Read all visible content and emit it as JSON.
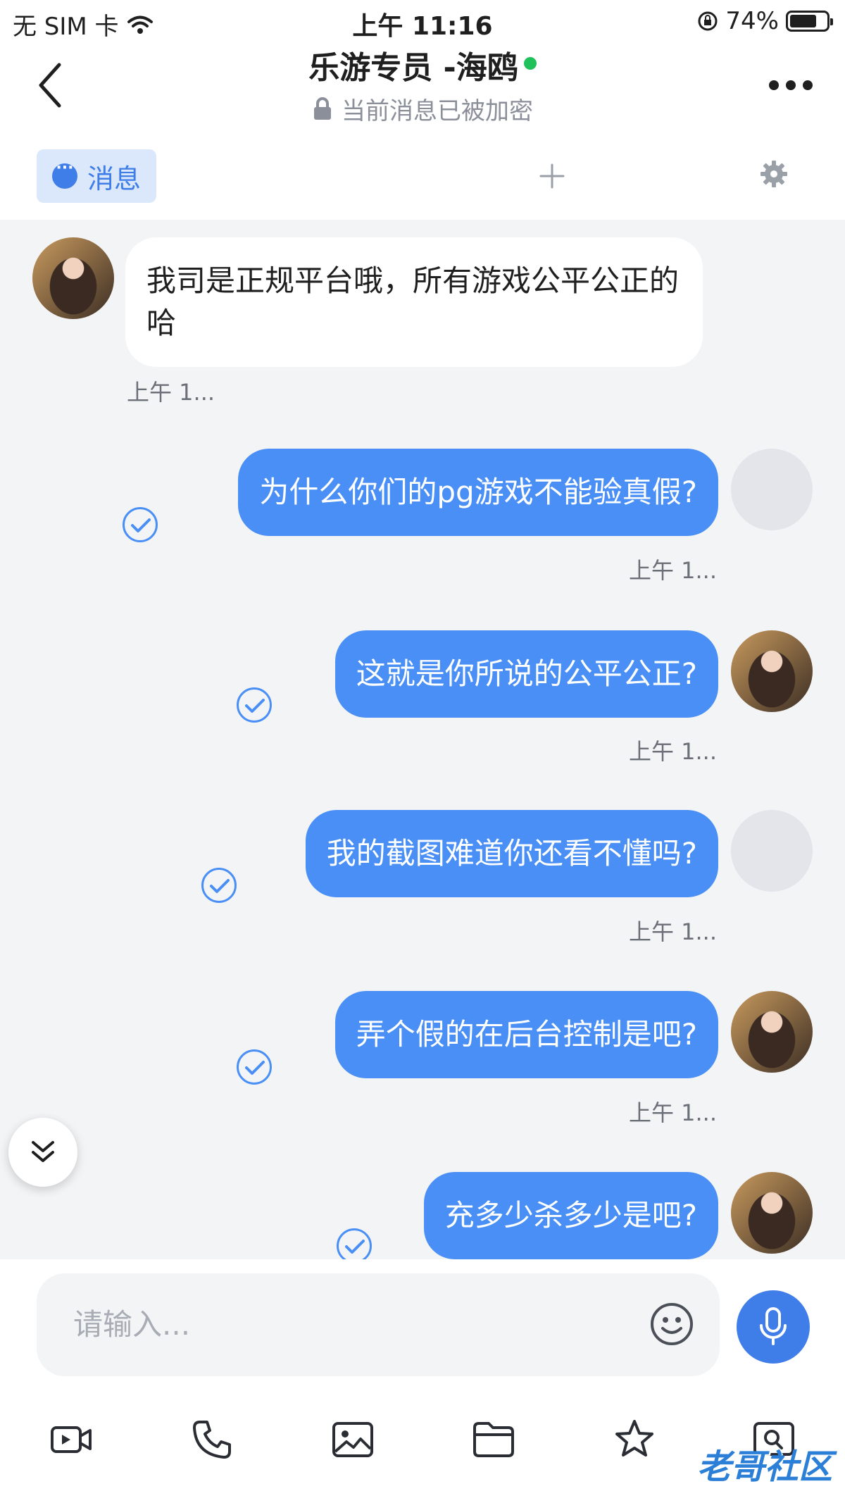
{
  "status_bar": {
    "carrier": "无 SIM 卡",
    "time": "上午 11:16",
    "battery": "74%",
    "battery_level": 0.74
  },
  "header": {
    "title": "乐游专员 -海鸥",
    "subtitle": "当前消息已被加密"
  },
  "tabs": {
    "messages_label": "消息"
  },
  "messages": [
    {
      "text": "我司是正规平台哦，所有游戏公平公正的哈",
      "time": "上午 1..."
    },
    {
      "text": "为什么你们的pg游戏不能验真假?",
      "time": "上午 1..."
    },
    {
      "text": "这就是你所说的公平公正?",
      "time": "上午 1..."
    },
    {
      "text": "我的截图难道你还看不懂吗?",
      "time": "上午 1..."
    },
    {
      "text": "弄个假的在后台控制是吧?",
      "time": "上午 1..."
    },
    {
      "text": "充多少杀多少是吧?"
    }
  ],
  "input": {
    "placeholder": "请输入..."
  },
  "watermark": "老哥社区",
  "colors": {
    "accent": "#4a8ff5",
    "online": "#20c15a",
    "chat_bg": "#f3f4f6"
  },
  "icons": [
    "back-icon",
    "lock-icon",
    "more-icon",
    "chat-bubble-icon",
    "plus-icon",
    "gear-icon",
    "check-icon",
    "double-chevron-down-icon",
    "emoji-icon",
    "mic-icon",
    "video-icon",
    "phone-icon",
    "image-icon",
    "folder-icon",
    "star-icon",
    "screenshot-icon"
  ]
}
